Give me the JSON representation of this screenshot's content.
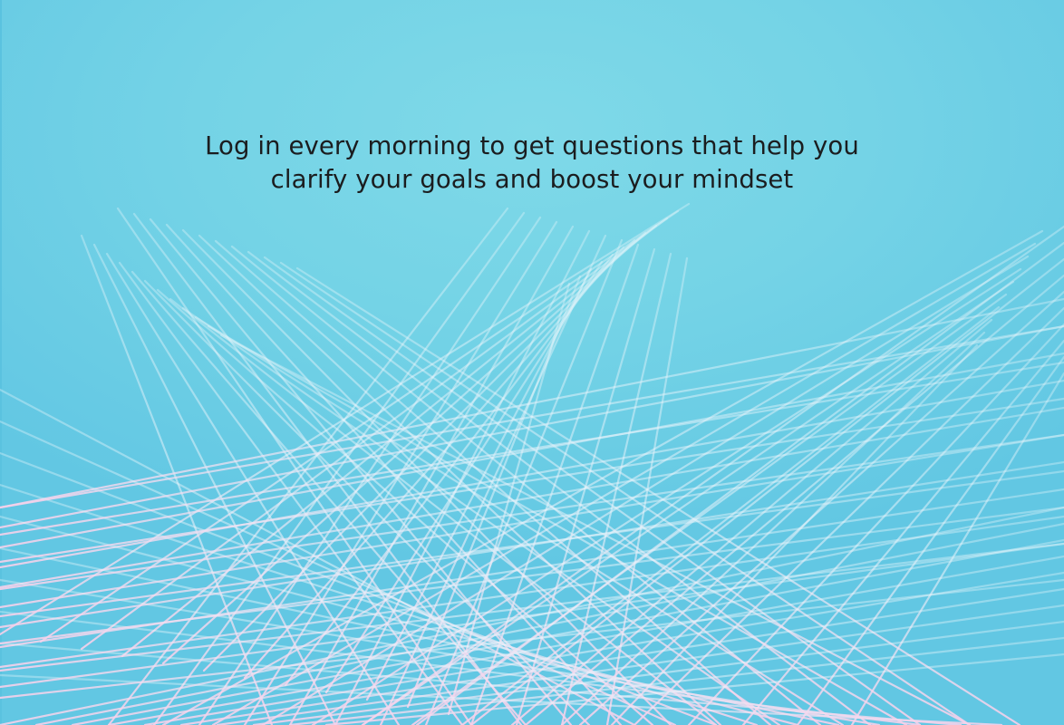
{
  "message": {
    "line1": "Log in every morning to get questions that help you",
    "line2": "clarify your goals and boost your mindset"
  },
  "theme": {
    "background": "#74d3e6",
    "line_color_light": "#e6f3fa",
    "line_color_pink": "#f4cfe8",
    "text_color": "#1b1d1f"
  },
  "background_pattern": "string-art-lines"
}
